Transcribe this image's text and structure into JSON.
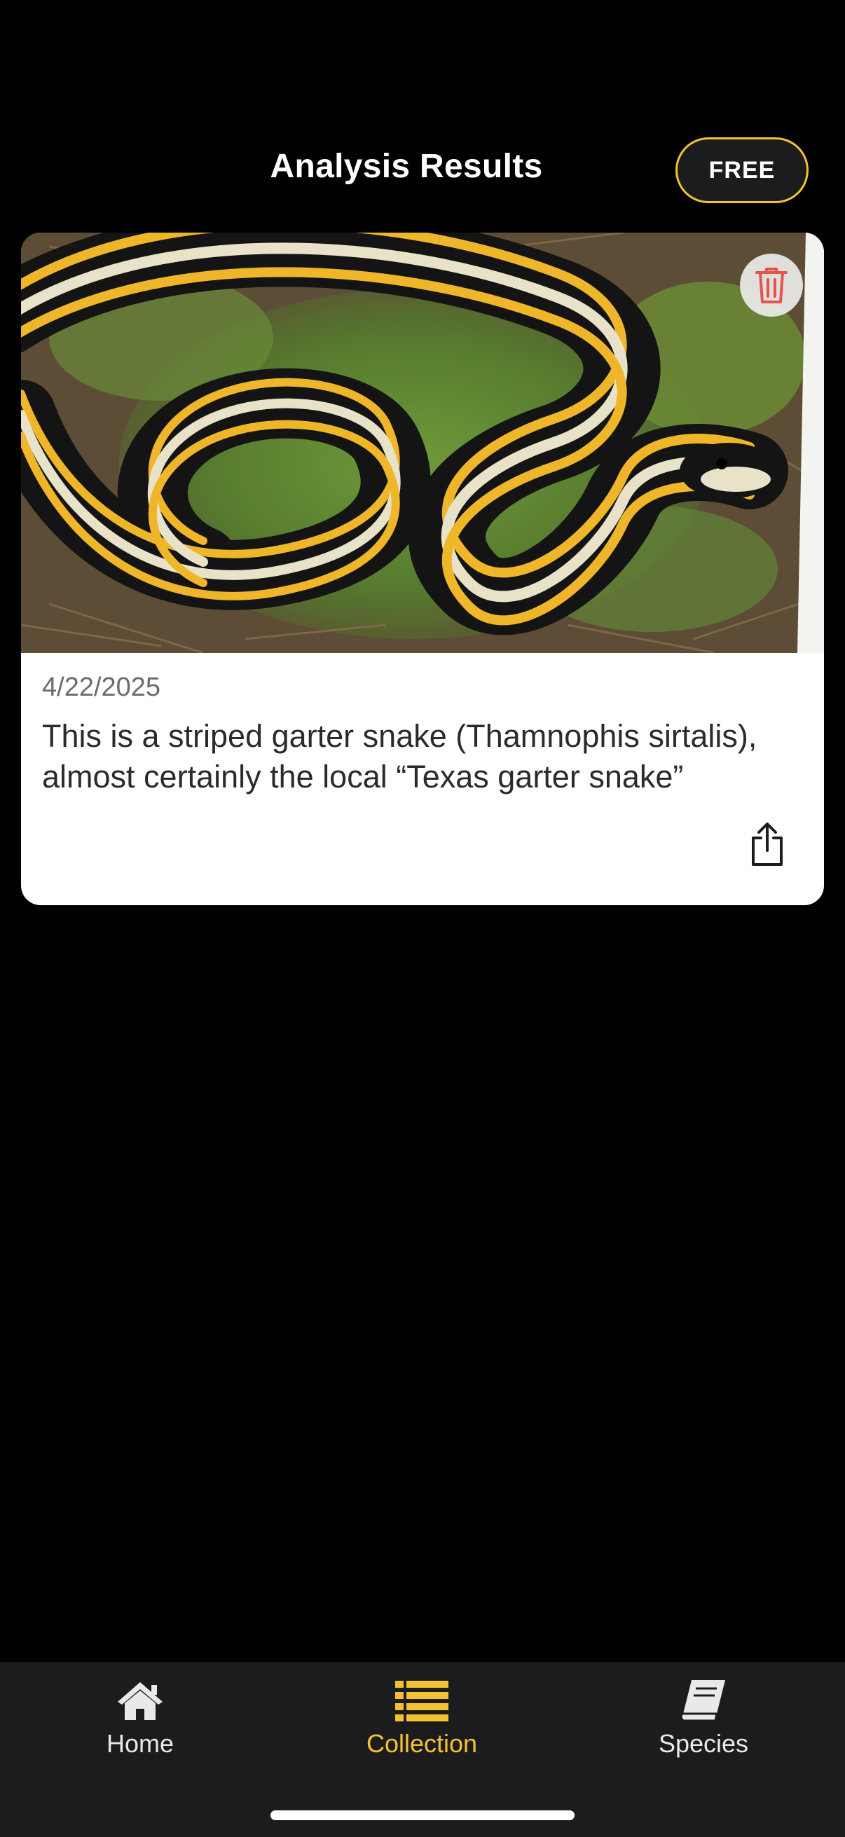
{
  "header": {
    "title": "Analysis Results",
    "plan_badge": "FREE"
  },
  "results": [
    {
      "date": "4/22/2025",
      "summary": "This is a striped garter snake (Thamnophis sirtalis), almost certainly the local “Texas garter snake”",
      "photo_icon": "snake-photo",
      "delete_icon": "trash-icon",
      "share_icon": "share-icon"
    }
  ],
  "tab_bar": {
    "items": [
      {
        "label": "Home",
        "icon": "home-icon",
        "active": false
      },
      {
        "label": "Collection",
        "icon": "list-icon",
        "active": true
      },
      {
        "label": "Species",
        "icon": "book-icon",
        "active": false
      }
    ]
  },
  "colors": {
    "accent": "#F4C230",
    "background": "#000000",
    "tab_bar": "#1c1c1e",
    "delete": "#E5534B"
  }
}
